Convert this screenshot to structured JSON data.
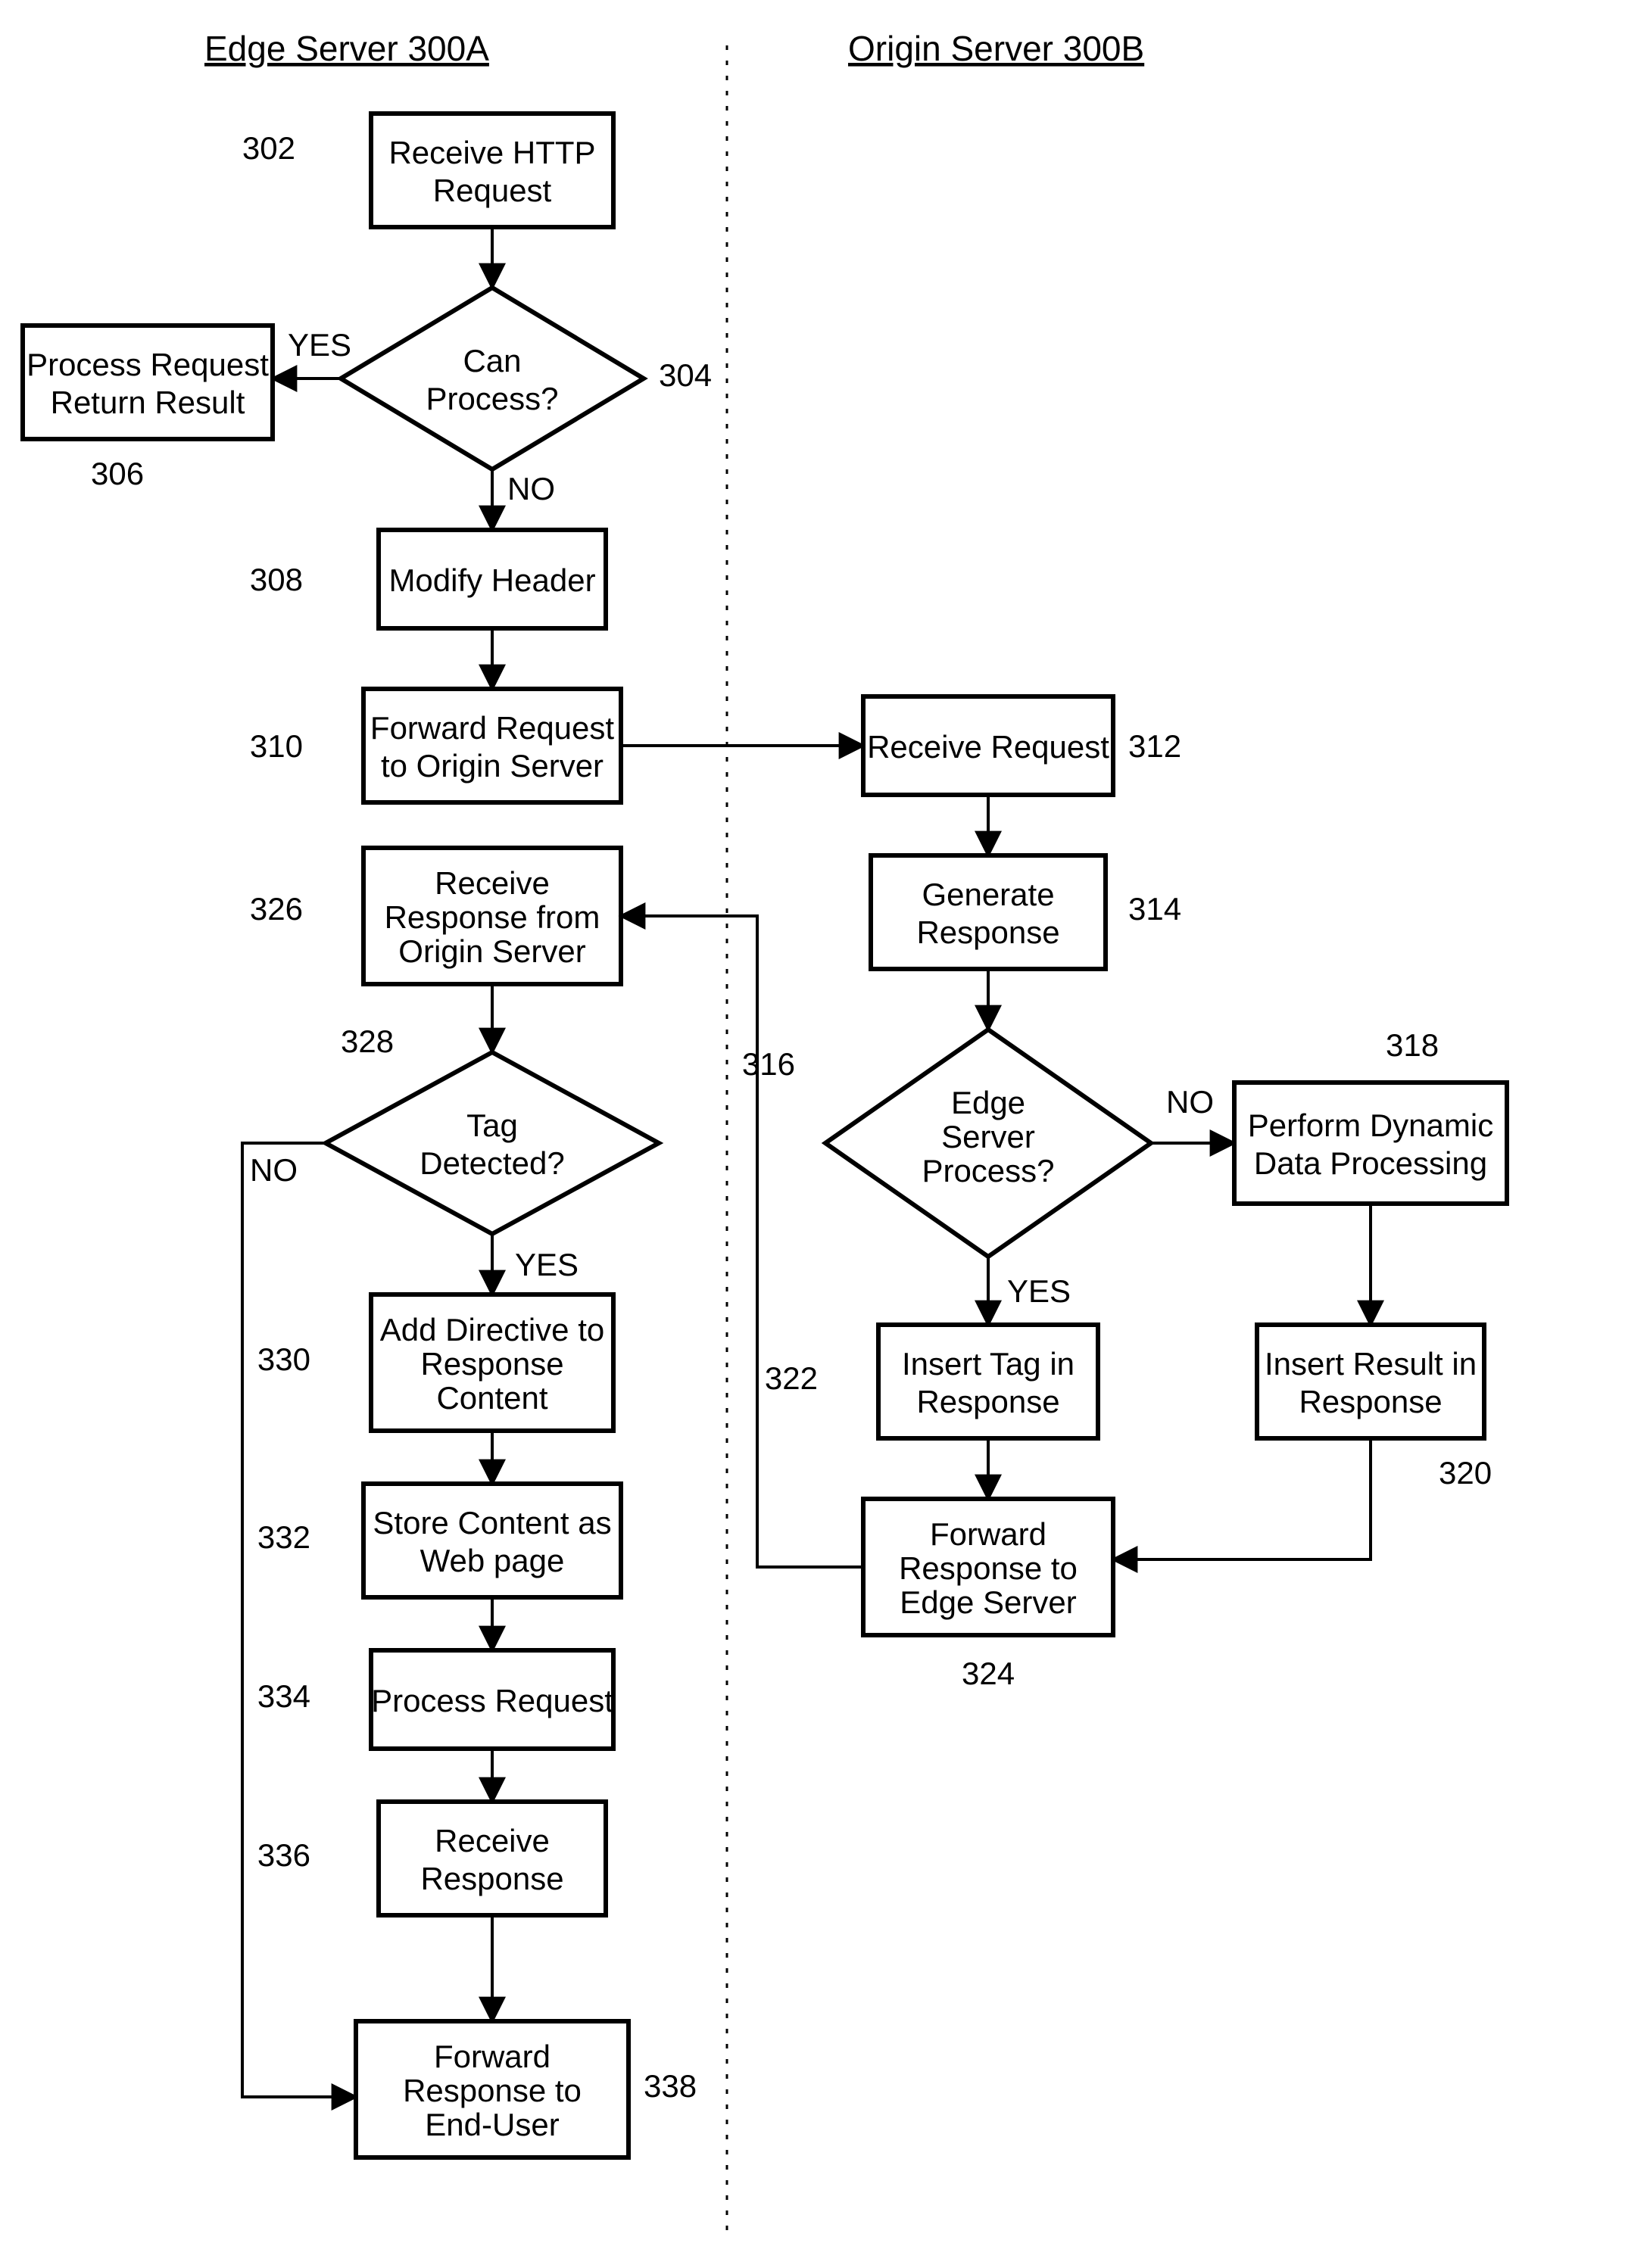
{
  "titles": {
    "left": "Edge Server 300A",
    "right": "Origin Server 300B"
  },
  "nodes": {
    "n302": "Receive HTTP Request",
    "n304": "Can Process?",
    "n306": "Process Request Return Result",
    "n308": "Modify Header",
    "n310": "Forward Request to Origin Server",
    "n312": "Receive Request",
    "n314": "Generate Response",
    "n316": "Edge Server Process?",
    "n318": "Perform Dynamic Data Processing",
    "n320": "Insert Result in Response",
    "n322": "Insert Tag in Response",
    "n324": "Forward Response to Edge Server",
    "n326": "Receive Response from Origin Server",
    "n328": "Tag Detected?",
    "n330": "Add Directive to Response Content",
    "n332": "Store Content as Web page",
    "n334": "Process Request",
    "n336": "Receive Response",
    "n338": "Forward Response to End-User"
  },
  "decisionLabels": {
    "yes": "YES",
    "no": "NO"
  },
  "refs": {
    "r302": "302",
    "r304": "304",
    "r306": "306",
    "r308": "308",
    "r310": "310",
    "r312": "312",
    "r314": "314",
    "r316": "316",
    "r318": "318",
    "r320": "320",
    "r322": "322",
    "r324": "324",
    "r326": "326",
    "r328": "328",
    "r330": "330",
    "r332": "332",
    "r334": "334",
    "r336": "336",
    "r338": "338"
  },
  "chart_data": {
    "type": "flowchart",
    "swimlanes": [
      "Edge Server 300A",
      "Origin Server 300B"
    ],
    "nodes": [
      {
        "id": "302",
        "lane": 0,
        "type": "process",
        "label": "Receive HTTP Request"
      },
      {
        "id": "304",
        "lane": 0,
        "type": "decision",
        "label": "Can Process?"
      },
      {
        "id": "306",
        "lane": 0,
        "type": "process",
        "label": "Process Request Return Result"
      },
      {
        "id": "308",
        "lane": 0,
        "type": "process",
        "label": "Modify Header"
      },
      {
        "id": "310",
        "lane": 0,
        "type": "process",
        "label": "Forward Request to Origin Server"
      },
      {
        "id": "312",
        "lane": 1,
        "type": "process",
        "label": "Receive Request"
      },
      {
        "id": "314",
        "lane": 1,
        "type": "process",
        "label": "Generate Response"
      },
      {
        "id": "316",
        "lane": 1,
        "type": "decision",
        "label": "Edge Server Process?"
      },
      {
        "id": "318",
        "lane": 1,
        "type": "process",
        "label": "Perform Dynamic Data Processing"
      },
      {
        "id": "320",
        "lane": 1,
        "type": "process",
        "label": "Insert Result in Response"
      },
      {
        "id": "322",
        "lane": 1,
        "type": "process",
        "label": "Insert Tag in Response"
      },
      {
        "id": "324",
        "lane": 1,
        "type": "process",
        "label": "Forward Response to Edge Server"
      },
      {
        "id": "326",
        "lane": 0,
        "type": "process",
        "label": "Receive Response from Origin Server"
      },
      {
        "id": "328",
        "lane": 0,
        "type": "decision",
        "label": "Tag Detected?"
      },
      {
        "id": "330",
        "lane": 0,
        "type": "process",
        "label": "Add Directive to Response Content"
      },
      {
        "id": "332",
        "lane": 0,
        "type": "process",
        "label": "Store Content as Web page"
      },
      {
        "id": "334",
        "lane": 0,
        "type": "process",
        "label": "Process Request"
      },
      {
        "id": "336",
        "lane": 0,
        "type": "process",
        "label": "Receive Response"
      },
      {
        "id": "338",
        "lane": 0,
        "type": "process",
        "label": "Forward Response to End-User"
      }
    ],
    "edges": [
      {
        "from": "302",
        "to": "304"
      },
      {
        "from": "304",
        "to": "306",
        "label": "YES"
      },
      {
        "from": "304",
        "to": "308",
        "label": "NO"
      },
      {
        "from": "308",
        "to": "310"
      },
      {
        "from": "310",
        "to": "312"
      },
      {
        "from": "312",
        "to": "314"
      },
      {
        "from": "314",
        "to": "316"
      },
      {
        "from": "316",
        "to": "318",
        "label": "NO"
      },
      {
        "from": "316",
        "to": "322",
        "label": "YES"
      },
      {
        "from": "318",
        "to": "320"
      },
      {
        "from": "320",
        "to": "324"
      },
      {
        "from": "322",
        "to": "324"
      },
      {
        "from": "324",
        "to": "326"
      },
      {
        "from": "326",
        "to": "328"
      },
      {
        "from": "328",
        "to": "330",
        "label": "YES"
      },
      {
        "from": "328",
        "to": "338",
        "label": "NO"
      },
      {
        "from": "330",
        "to": "332"
      },
      {
        "from": "332",
        "to": "334"
      },
      {
        "from": "334",
        "to": "336"
      },
      {
        "from": "336",
        "to": "338"
      }
    ]
  }
}
